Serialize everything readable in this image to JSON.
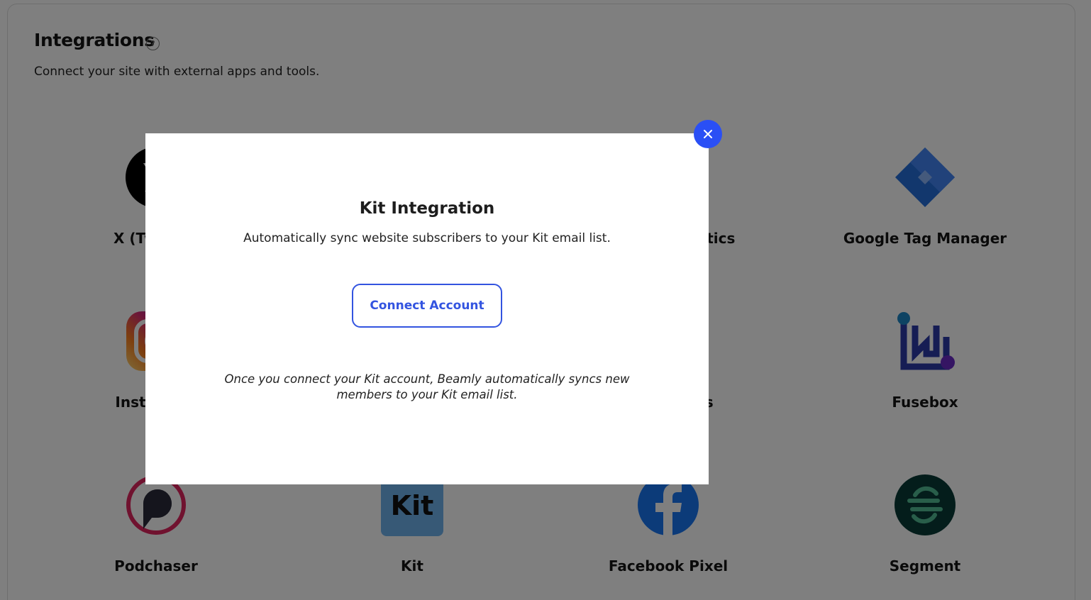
{
  "header": {
    "title": "Integrations",
    "help_icon": "?",
    "subtitle": "Connect your site with external apps and tools."
  },
  "integrations": [
    {
      "label": "X (Twitter)",
      "icon": "x-logo"
    },
    {
      "label": "Google Analytics",
      "icon": "google-analytics-logo"
    },
    {
      "label": "Google Tag Manager",
      "icon": "google-tag-manager-logo"
    },
    {
      "label": "Instagram",
      "icon": "instagram-logo"
    },
    {
      "label": "Google Ads",
      "icon": "google-ads-logo"
    },
    {
      "label": "Fusebox",
      "icon": "fusebox-logo"
    },
    {
      "label": "Podchaser",
      "icon": "podchaser-logo"
    },
    {
      "label": "Kit",
      "icon": "kit-logo",
      "logo_text": "Kit"
    },
    {
      "label": "Facebook Pixel",
      "icon": "facebook-logo"
    },
    {
      "label": "Segment",
      "icon": "segment-logo"
    }
  ],
  "modal": {
    "title": "Kit Integration",
    "description": "Automatically sync website subscribers to your Kit email list.",
    "connect_label": "Connect Account",
    "note": "Once you connect your Kit account, Beamly automatically syncs new members to your Kit email list.",
    "close_icon": "close-icon"
  },
  "colors": {
    "accent": "#2a4ff5",
    "button_text": "#3354e0",
    "overlay": "rgba(0,0,0,0.5)"
  }
}
